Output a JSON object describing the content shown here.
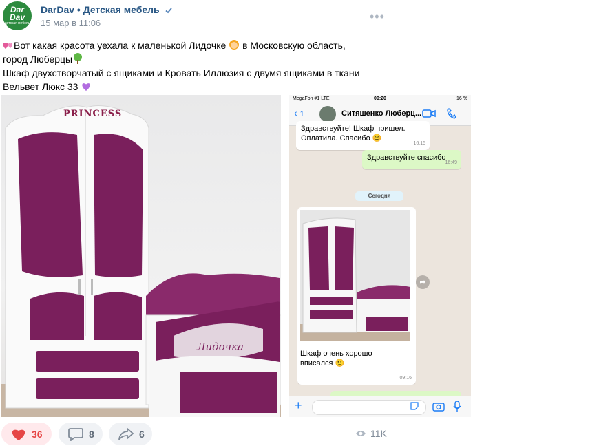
{
  "post": {
    "author": "DarDav • Детская мебель",
    "date": "15 мар в 11:06",
    "avatar_text_top": "Dar",
    "avatar_text_bottom": "Dav",
    "avatar_sub": "детская мебель",
    "text_line1": "Вот какая красота уехала к маленькой Лидочке ",
    "text_line1b": " в Московскую область,",
    "text_line2": "город Люберцы",
    "text_line3": "Шкаф двухстворчатый с ящиками и Кровать Иллюзия с двумя ящиками в ткани",
    "text_line4": "Вельвет Люкс 33 "
  },
  "photo1": {
    "crown_label": "PRINCESS",
    "name_label": "Лидочка",
    "fabric_color": "#7a1f5c"
  },
  "chat": {
    "carrier": "MegaFon #1  LTE",
    "time": "09:20",
    "battery": "16 %",
    "back_count": "1",
    "contact": "Ситяшенко Люберц...",
    "msg1": "Здравствуйте! Шкаф пришел. Оплатила. Спасибо",
    "msg1_time": "16:15",
    "msg2": "Здравствуйте спасибо",
    "msg2_time": "16:49",
    "day": "Сегодня",
    "msg3": "Шкаф очень хорошо вписался",
    "msg3_time": "09:16"
  },
  "footer": {
    "likes": "36",
    "comments": "8",
    "shares": "6",
    "views": "11K"
  },
  "colors": {
    "link": "#2a5885",
    "like": "#e64646",
    "accent_green": "#2c8a3e"
  },
  "icons": [
    "verified-icon",
    "more-icon",
    "heart-icon",
    "comment-icon",
    "share-icon",
    "eye-icon",
    "camera-icon",
    "mic-icon",
    "video-call-icon",
    "phone-icon"
  ]
}
